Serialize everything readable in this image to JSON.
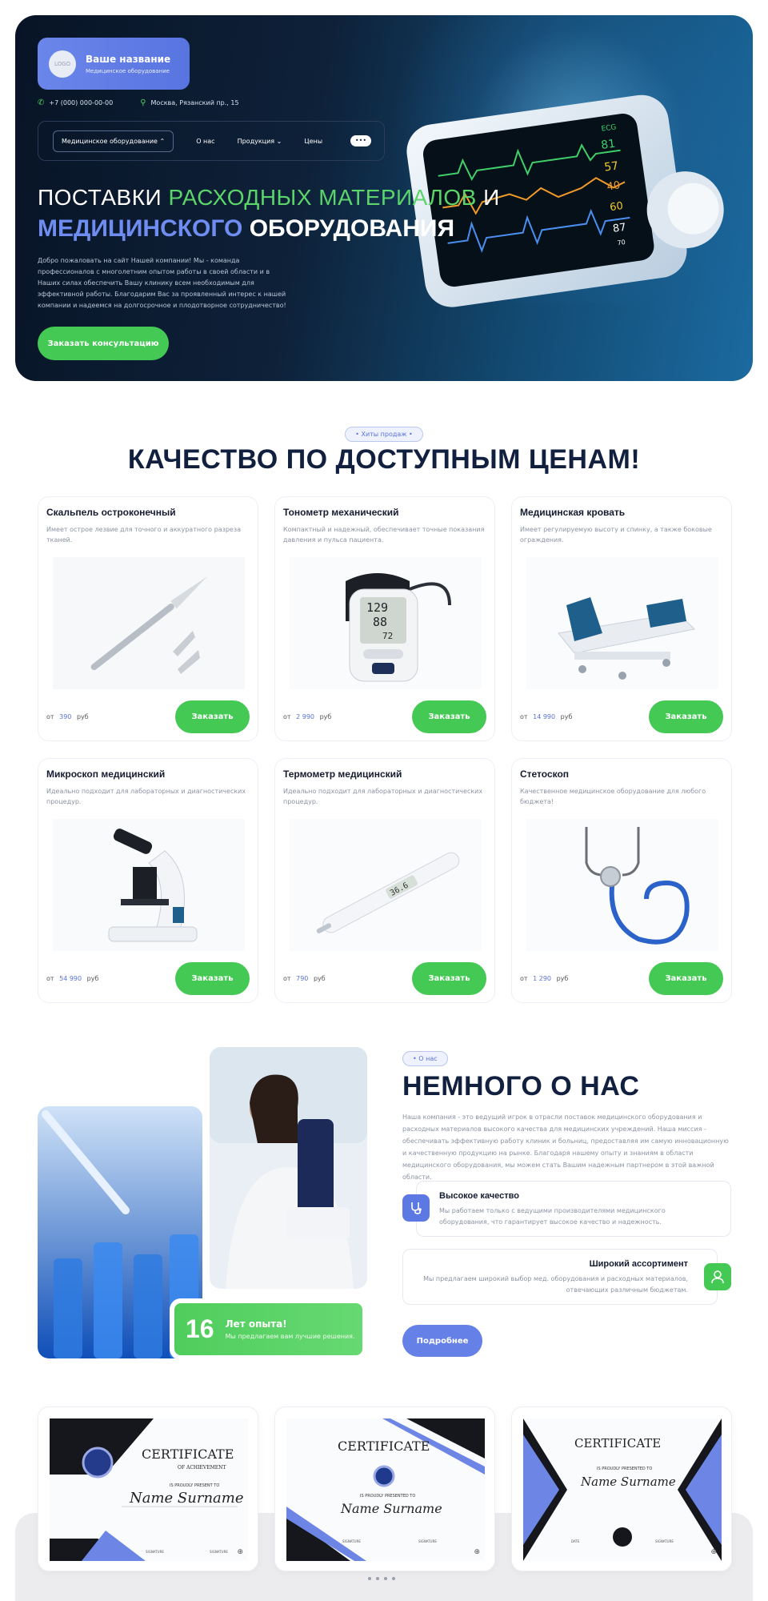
{
  "header": {
    "logo_placeholder": "LOGO",
    "company_name": "Ваше название",
    "company_sub": "Медицинское оборудование",
    "phone": "+7 (000) 000-00-00",
    "address": "Москва, Рязанский пр., 15",
    "nav": {
      "dropdown": "Медицинское оборудование",
      "about": "О нас",
      "products": "Продукция",
      "prices": "Цены",
      "more": "•••"
    }
  },
  "hero": {
    "line1_part1": "ПОСТАВКИ",
    "line1_accent": "РАСХОДНЫХ МАТЕРИАЛОВ",
    "line1_part2": "И",
    "line2_accent": "МЕДИЦИНСКОГО",
    "line2_part": "ОБОРУДОВАНИЯ",
    "text": "Добро пожаловать на сайт Нашей компании! Мы - команда профессионалов с многолетним опытом работы в своей области и в Наших силах обеспечить Вашу клинику всем необходимым для эффективной работы. Благодарим Вас за проявленный интерес к нашей компании и надеемся на долгосрочное и плодотворное сотрудничество!",
    "cta": "Заказать консультацию",
    "monitor": {
      "ecg": "ECG",
      "v1": "81",
      "v2": "57",
      "v3": "40",
      "v4": "60",
      "v5": "87",
      "v6": "70"
    }
  },
  "products": {
    "pill": "Хиты продаж",
    "title": "КАЧЕСТВО ПО ДОСТУПНЫМ ЦЕНАМ!",
    "price_prefix": "от",
    "price_suffix": "руб",
    "order_label": "Заказать",
    "items": [
      {
        "title": "Скальпель остроконечный",
        "desc": "Имеет острое лезвие для точного и аккуратного разреза тканей.",
        "price": "390"
      },
      {
        "title": "Тонометр механический",
        "desc": "Компактный и надежный, обеспечивает точные показания давления и пульса пациента.",
        "price": "2 990"
      },
      {
        "title": "Медицинская кровать",
        "desc": "Имеет регулируемую высоту и спинку, а также боковые ограждения.",
        "price": "14 990"
      },
      {
        "title": "Микроскоп медицинский",
        "desc": "Идеально подходит для лабораторных и диагностических процедур.",
        "price": "54 990"
      },
      {
        "title": "Термометр медицинский",
        "desc": "Идеально подходит для лабораторных и диагностических процедур.",
        "price": "790"
      },
      {
        "title": "Стетоскоп",
        "desc": "Качественное медицинское оборудование для любого бюджета!",
        "price": "1 290"
      }
    ],
    "tonometer": {
      "d1": "129",
      "d2": "88",
      "d3": "72"
    },
    "thermometer": "36.6"
  },
  "about": {
    "pill": "О нас",
    "title": "НЕМНОГО О НАС",
    "text": "Наша компания - это ведущий игрок в отрасли поставок медицинского оборудования и расходных материалов высокого качества для медицинских учреждений. Наша миссия - обеспечивать эффективную работу клиник и больниц, предоставляя им самую инновационную и качественную продукцию на рынке. Благодаря нашему опыту и знаниям в области медицинского оборудования, мы можем стать Вашим надежным партнером в этой важной области.",
    "years_value": "16",
    "years_label": "Лет опыта!",
    "years_sub": "Мы предлагаем вам лучшие решения.",
    "feature1_title": "Высокое качество",
    "feature1_desc": "Мы работаем только с ведущими производителями медицинского оборудования, что гарантирует высокое качество и надежность.",
    "feature2_title": "Широкий ассортимент",
    "feature2_desc": "Мы предлагаем широкий выбор мед. оборудования и расходных материалов, отвечающих различным бюджетам.",
    "button": "Подробнее"
  },
  "certificates": {
    "items": [
      {
        "title": "CERTIFICATE",
        "sub": "OF ACHIEVEMENT",
        "present": "IS PROUDLY PRESENT TO",
        "name": "Name Surname",
        "sig1": "SIGNATURE",
        "sig2": "SIGNATURE"
      },
      {
        "title": "CERTIFICATE",
        "present": "IS PROUDLY PRESENTED TO",
        "name": "Name Surname",
        "sig1": "SIGNATURE",
        "sig2": "SIGNATURE"
      },
      {
        "title": "CERTIFICATE",
        "present": "IS PROUDLY PRESENTED TO",
        "name": "Name Surname",
        "sig1": "DATE",
        "sig2": "SIGNATURE"
      }
    ]
  },
  "colors": {
    "accent_green": "#45c955",
    "accent_blue": "#6b86ea",
    "dark": "#12203f"
  },
  "icons": [
    "phone-icon",
    "location-icon",
    "chevron-down-icon",
    "stethoscope-icon",
    "doctor-icon",
    "zoom-icon"
  ]
}
